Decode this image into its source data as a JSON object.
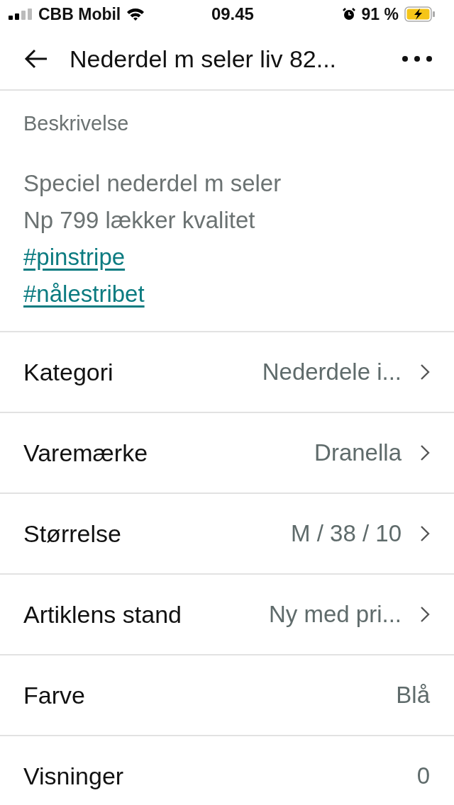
{
  "status_bar": {
    "carrier": "CBB Mobil",
    "time": "09.45",
    "battery": "91 %"
  },
  "header": {
    "title": "Nederdel m seler liv 82..."
  },
  "description": {
    "heading": "Beskrivelse",
    "lines": [
      {
        "kind": "text",
        "text": "Speciel nederdel m seler"
      },
      {
        "kind": "text",
        "text": "Np 799 lækker kvalitet"
      },
      {
        "kind": "hashtag",
        "text": "#pinstripe"
      },
      {
        "kind": "hashtag",
        "text": "#nålestribet"
      }
    ]
  },
  "details": [
    {
      "label": "Kategori",
      "value": "Nederdele i...",
      "chevron": true
    },
    {
      "label": "Varemærke",
      "value": "Dranella",
      "chevron": true
    },
    {
      "label": "Størrelse",
      "value": "M / 38 / 10",
      "chevron": true
    },
    {
      "label": "Artiklens stand",
      "value": "Ny med pri...",
      "chevron": true
    },
    {
      "label": "Farve",
      "value": "Blå",
      "chevron": false
    },
    {
      "label": "Visninger",
      "value": "0",
      "chevron": false
    }
  ]
}
